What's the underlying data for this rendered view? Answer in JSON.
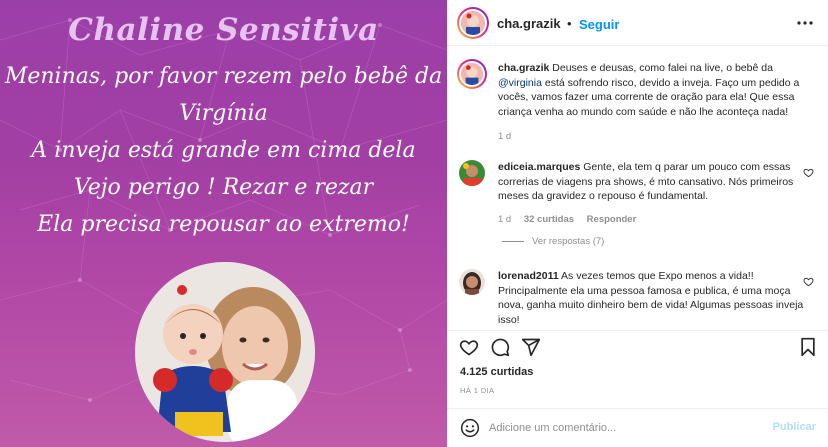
{
  "image": {
    "title": "Chaline Sensitiva",
    "lines": [
      "Meninas, por favor rezem pelo bebê da",
      "Virgínia",
      "A inveja está grande em cima dela",
      "Vejo perigo ! Rezar e rezar",
      "Ela precisa repousar ao extremo!"
    ]
  },
  "header": {
    "username": "cha.grazik",
    "separator": "•",
    "follow_label": "Seguir"
  },
  "caption": {
    "username": "cha.grazik",
    "text_before": " Deuses e deusas, como falei na live, o bebê da ",
    "mention": "@virginia",
    "text_after": " está sofrendo risco, devido a inveja. Faço um pedido a vocês, vamos fazer uma corrente de oração para ela! Que essa criança venha ao mundo com saúde e não lhe aconteça nada!",
    "time": "1 d"
  },
  "comments": [
    {
      "username": "ediceia.marques",
      "text": " Gente, ela tem q parar um pouco com essas correrias de viagens pra shows, é mto cansativo. Nós primeiros meses da gravidez o repouso é fundamental.",
      "time": "1 d",
      "likes": "32 curtidas",
      "reply_label": "Responder",
      "view_replies": "Ver respostas (7)"
    },
    {
      "username": "lorenad2011",
      "text": " As vezes temos que Expo menos a vida!! Principalmente ela uma pessoa famosa e publica, é uma moça nova, ganha muito dinheiro bem de vida! Algumas pessoas inveja isso!"
    }
  ],
  "footer": {
    "likes": "4.125 curtidas",
    "time_ago": "HÁ 1 DIA",
    "comment_placeholder": "Adicione um comentário...",
    "post_label": "Publicar"
  },
  "colors": {
    "image_bg": "#a23fa4",
    "title": "#e7c3f1",
    "link": "#0095f6",
    "mention": "#00376b",
    "post_disabled": "#b2dffc"
  },
  "icons": {
    "more": "more-options-icon",
    "like": "heart-icon",
    "comment": "comment-icon",
    "share": "share-icon",
    "save": "bookmark-icon",
    "emoji": "emoji-icon"
  }
}
